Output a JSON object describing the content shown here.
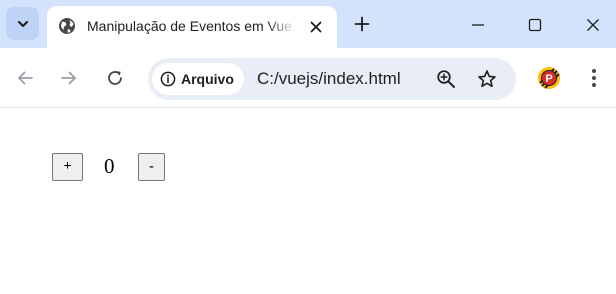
{
  "browser": {
    "tab": {
      "title": "Manipulação de Eventos em Vue.js"
    },
    "address_bar": {
      "security_label": "Arquivo",
      "url": "C:/vuejs/index.html"
    },
    "extension_badge": "P"
  },
  "page": {
    "increment_label": "+",
    "counter_value": "0",
    "decrement_label": "-"
  },
  "colors": {
    "titlebar": "#d3e3fd",
    "omnibox": "#e9eef6",
    "icon": "#474747",
    "extension_red": "#d93025",
    "extension_yellow": "#fbbc04"
  }
}
